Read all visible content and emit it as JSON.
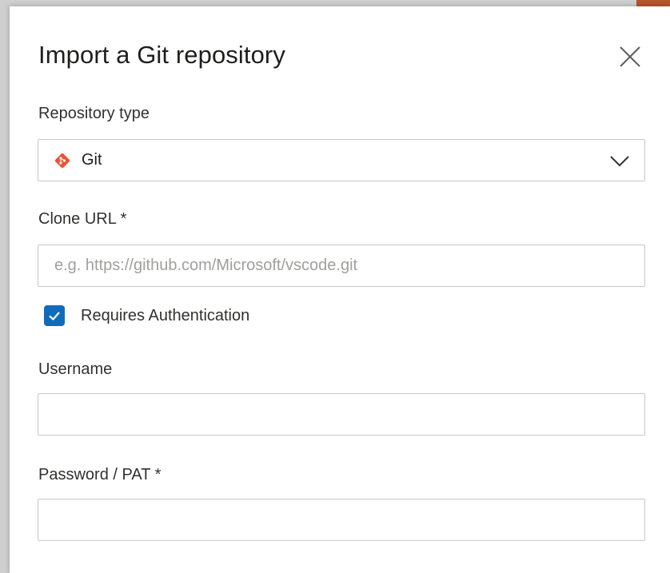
{
  "dialog": {
    "title": "Import a Git repository",
    "close_icon": "close-icon"
  },
  "repository_type": {
    "label": "Repository type",
    "selected_value": "Git",
    "icon": "git-logo-icon",
    "icon_color": "#f05033"
  },
  "clone_url": {
    "label": "Clone URL *",
    "value": "",
    "placeholder": "e.g. https://github.com/Microsoft/vscode.git"
  },
  "requires_authentication": {
    "label": "Requires Authentication",
    "checked": true,
    "accent_color": "#0f6cbd"
  },
  "username": {
    "label": "Username",
    "value": "",
    "placeholder": ""
  },
  "password": {
    "label": "Password / PAT *",
    "value": "",
    "placeholder": ""
  }
}
